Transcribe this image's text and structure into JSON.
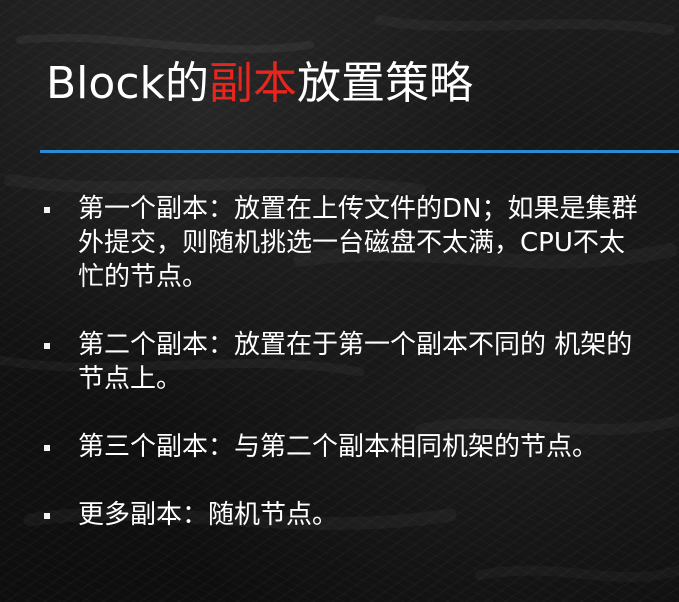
{
  "slide": {
    "title_prefix": "Block的",
    "title_highlight": "副本",
    "title_suffix": "放置策略",
    "colors": {
      "title": "#ffffff",
      "highlight": "#e8261e",
      "rule": "#2b8bd4",
      "background": "#141414"
    },
    "bullets": [
      {
        "text": "第一个副本：放置在上传文件的DN；如果是集群外提交，则随机挑选一台磁盘不太满，CPU不太忙的节点。"
      },
      {
        "text": "第二个副本：放置在于第一个副本不同的 机架的节点上。"
      },
      {
        "text": "第三个副本：与第二个副本相同机架的节点。"
      },
      {
        "text": "更多副本：随机节点。"
      }
    ]
  }
}
